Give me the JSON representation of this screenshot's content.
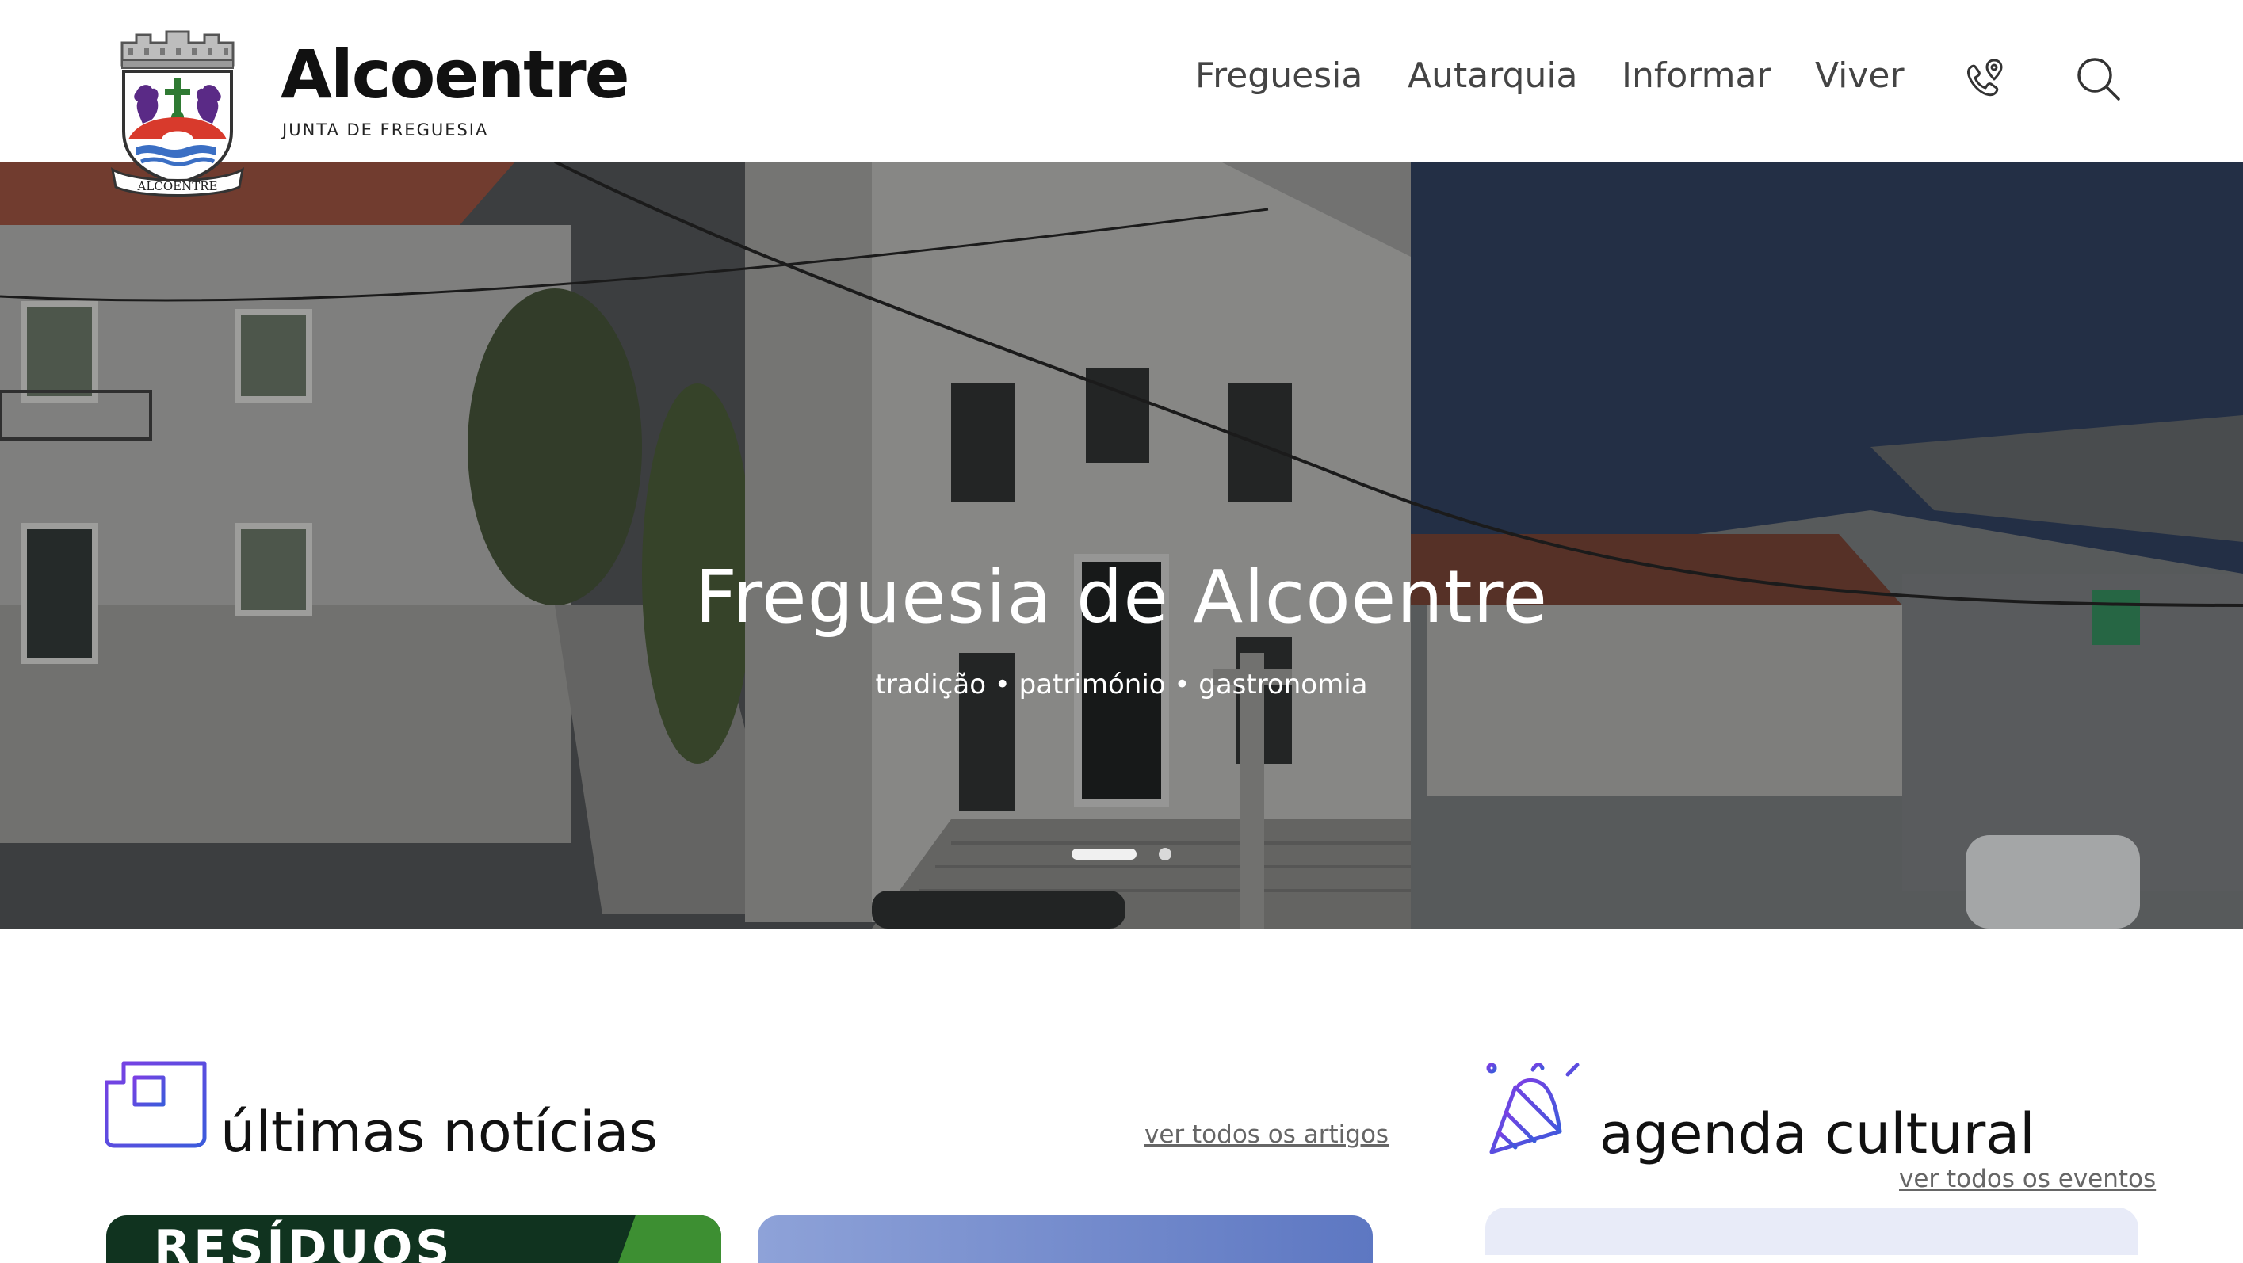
{
  "header": {
    "brand_name": "Alcoentre",
    "brand_subtitle": "JUNTA DE FREGUESIA",
    "crest_scroll_text": "ALCOENTRE",
    "nav": [
      "Freguesia",
      "Autarquia",
      "Informar",
      "Viver"
    ],
    "icons": [
      "phone-location-icon",
      "search-icon"
    ]
  },
  "hero": {
    "title": "Freguesia de Alcoentre",
    "subtitle": "tradição • património • gastronomia",
    "slides": 2,
    "active_slide": 1
  },
  "news": {
    "title": "últimas notícias",
    "link": "ver todos os artigos",
    "first_card_text": "RESÍDUOS"
  },
  "agenda": {
    "title": "agenda cultural",
    "link": "ver todos os eventos"
  },
  "colors": {
    "accent_gradient_start": "#7b3fe4",
    "accent_gradient_end": "#3b5bdb",
    "header_bg": "#ffffff"
  }
}
